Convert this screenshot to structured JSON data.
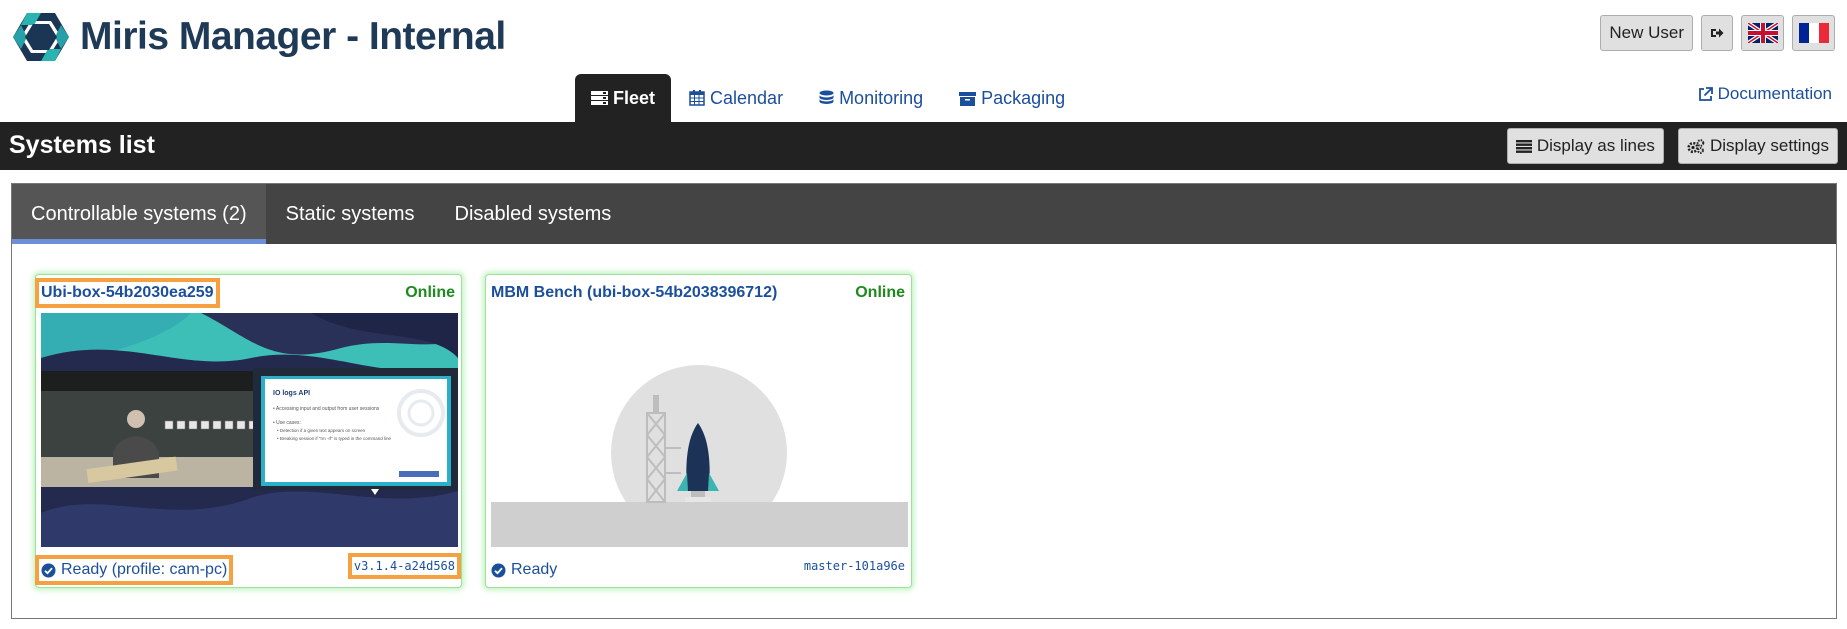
{
  "app": {
    "title": "Miris Manager - Internal"
  },
  "header": {
    "new_user_label": "New User",
    "logout_icon": "sign-out-icon",
    "languages": [
      "en-flag",
      "fr-flag"
    ]
  },
  "nav": {
    "items": [
      {
        "label": "Fleet",
        "icon": "server-icon",
        "active": true
      },
      {
        "label": "Calendar",
        "icon": "calendar-icon",
        "active": false
      },
      {
        "label": "Monitoring",
        "icon": "database-icon",
        "active": false
      },
      {
        "label": "Packaging",
        "icon": "archive-icon",
        "active": false
      }
    ],
    "documentation_label": "Documentation"
  },
  "section": {
    "title": "Systems list",
    "display_lines_label": "Display as lines",
    "display_settings_label": "Display settings"
  },
  "tabs": [
    {
      "label": "Controllable systems (2)",
      "active": true
    },
    {
      "label": "Static systems",
      "active": false
    },
    {
      "label": "Disabled systems",
      "active": false
    }
  ],
  "systems": [
    {
      "name": "Ubi-box-54b2030ea259",
      "status": "Online",
      "ready": "Ready (profile: cam-pc)",
      "version": "v3.1.4-a24d568",
      "slide_title": "IO logs API",
      "slide_line1": "• Accessing input and output from user sessions",
      "slide_line2": "• Use cases:",
      "slide_line3": "• Detection if a given text appears on screen",
      "slide_line4": "• Breaking session if \"rm -rf\" is typed in the command line"
    },
    {
      "name": "MBM Bench (ubi-box-54b2038396712)",
      "status": "Online",
      "ready": "Ready",
      "version": "master-101a96e"
    }
  ],
  "colors": {
    "accent": "#1b4f9c",
    "online": "#1e8a1e",
    "highlight": "#f5a142",
    "dark_bar": "#222222"
  }
}
